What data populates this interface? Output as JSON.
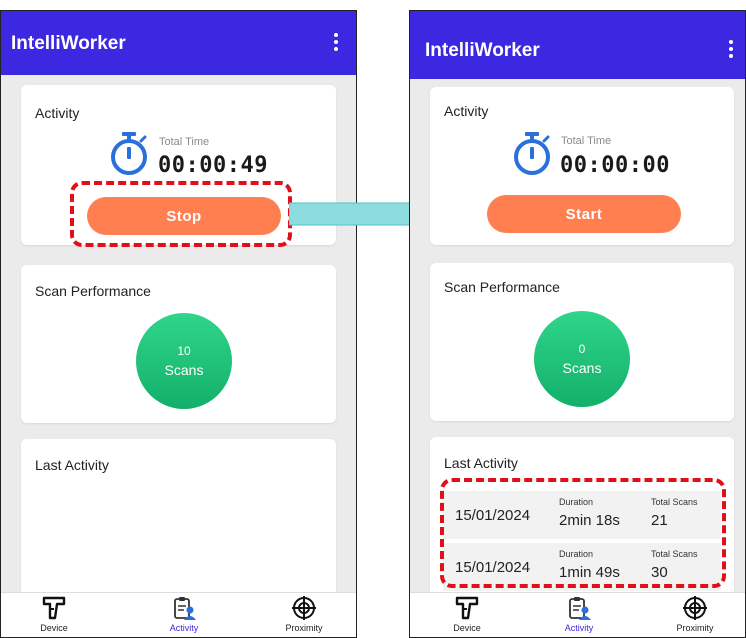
{
  "colors": {
    "appbar": "#3b28e0",
    "button": "#ff7f50",
    "scan_circle": "#1ec47b",
    "highlight": "#e0101a",
    "arrow": "#8ddde0"
  },
  "left": {
    "app_title": "IntelliWorker",
    "activity": {
      "heading": "Activity",
      "total_time_label": "Total Time",
      "total_time": "00:00:49",
      "button_label": "Stop"
    },
    "scan": {
      "heading": "Scan Performance",
      "count": "10",
      "unit": "Scans"
    },
    "last_activity": {
      "heading": "Last Activity"
    },
    "nav": [
      {
        "label": "Device",
        "icon": "scanner-icon"
      },
      {
        "label": "Activity",
        "icon": "clipboard-user-icon"
      },
      {
        "label": "Proximity",
        "icon": "crosshair-icon"
      }
    ]
  },
  "right": {
    "app_title": "IntelliWorker",
    "activity": {
      "heading": "Activity",
      "total_time_label": "Total Time",
      "total_time": "00:00:00",
      "button_label": "Start"
    },
    "scan": {
      "heading": "Scan Performance",
      "count": "0",
      "unit": "Scans"
    },
    "last_activity": {
      "heading": "Last Activity",
      "duration_label": "Duration",
      "scans_label": "Total Scans",
      "rows": [
        {
          "date": "15/01/2024",
          "duration": "2min 18s",
          "scans": "21"
        },
        {
          "date": "15/01/2024",
          "duration": "1min 49s",
          "scans": "30"
        }
      ]
    },
    "nav": [
      {
        "label": "Device",
        "icon": "scanner-icon"
      },
      {
        "label": "Activity",
        "icon": "clipboard-user-icon"
      },
      {
        "label": "Proximity",
        "icon": "crosshair-icon"
      }
    ]
  }
}
